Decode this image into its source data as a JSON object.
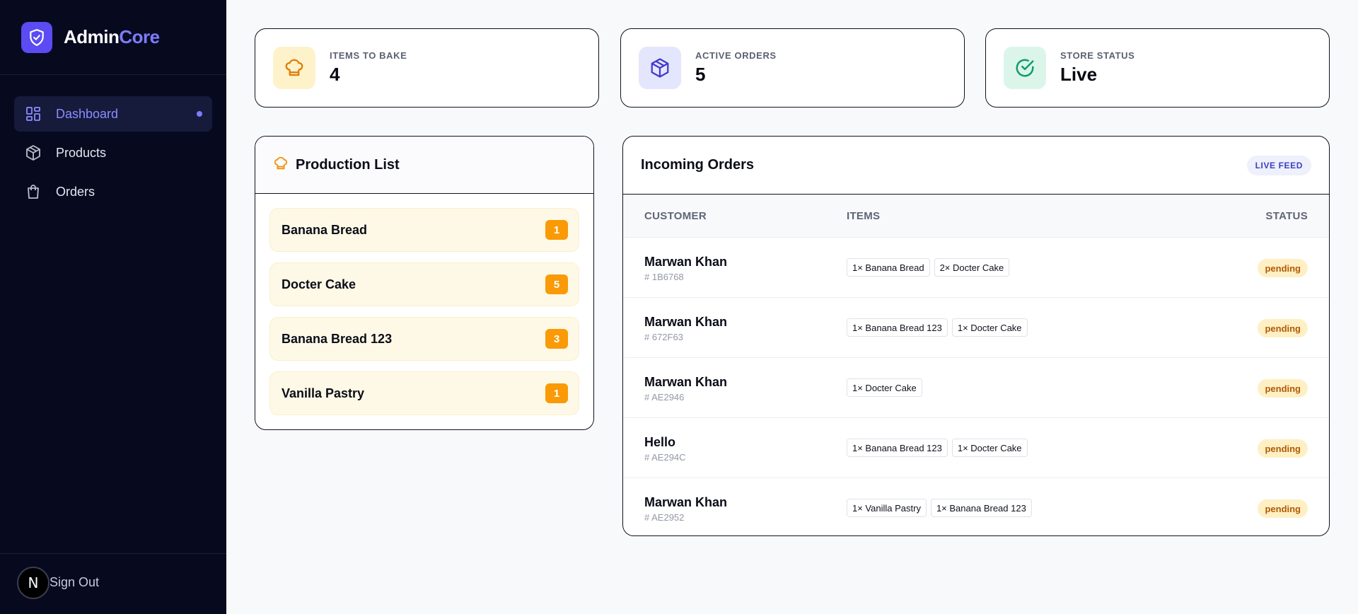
{
  "brand": {
    "part1": "Admin",
    "part2": "Core"
  },
  "sidebar": {
    "items": [
      {
        "label": "Dashboard",
        "icon": "dashboard-grid-icon",
        "active": true
      },
      {
        "label": "Products",
        "icon": "box-icon",
        "active": false
      },
      {
        "label": "Orders",
        "icon": "shopping-bag-icon",
        "active": false
      }
    ],
    "avatar_letter": "N",
    "signout_label": "Sign Out"
  },
  "stats": [
    {
      "label": "ITEMS TO BAKE",
      "value": "4",
      "icon": "chef-hat-icon",
      "color": "#fdf2c9"
    },
    {
      "label": "ACTIVE ORDERS",
      "value": "5",
      "icon": "package-icon",
      "color": "#e4e6fd"
    },
    {
      "label": "STORE STATUS",
      "value": "Live",
      "icon": "check-circle-icon",
      "color": "#dcf5ea"
    }
  ],
  "production": {
    "title": "Production List",
    "items": [
      {
        "name": "Banana Bread",
        "count": "1"
      },
      {
        "name": "Docter Cake",
        "count": "5"
      },
      {
        "name": "Banana Bread 123",
        "count": "3"
      },
      {
        "name": "Vanilla Pastry",
        "count": "1"
      }
    ]
  },
  "orders": {
    "title": "Incoming Orders",
    "badge": "LIVE FEED",
    "columns": {
      "customer": "CUSTOMER",
      "items": "ITEMS",
      "status": "STATUS"
    },
    "rows": [
      {
        "customer": "Marwan Khan",
        "id": "# 1B6768",
        "items": [
          "1× Banana Bread",
          "2× Docter Cake"
        ],
        "status": "pending"
      },
      {
        "customer": "Marwan Khan",
        "id": "# 672F63",
        "items": [
          "1× Banana Bread 123",
          "1× Docter Cake"
        ],
        "status": "pending"
      },
      {
        "customer": "Marwan Khan",
        "id": "# AE2946",
        "items": [
          "1× Docter Cake"
        ],
        "status": "pending"
      },
      {
        "customer": "Hello",
        "id": "# AE294C",
        "items": [
          "1× Banana Bread 123",
          "1× Docter Cake"
        ],
        "status": "pending"
      },
      {
        "customer": "Marwan Khan",
        "id": "# AE2952",
        "items": [
          "1× Vanilla Pastry",
          "1× Banana Bread 123"
        ],
        "status": "pending"
      }
    ]
  },
  "colors": {
    "accent": "#5b4bf3",
    "sidebar_bg": "#070a1e",
    "badge_orange": "#f99a06",
    "pending_bg": "#fef0c4"
  }
}
